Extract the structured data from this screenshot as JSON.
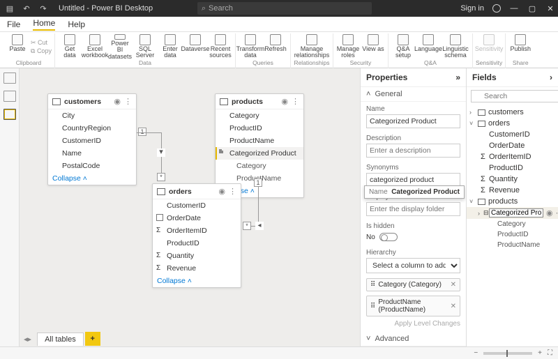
{
  "titlebar": {
    "title": "Untitled - Power BI Desktop",
    "search_placeholder": "Search",
    "signin": "Sign in"
  },
  "menu": {
    "file": "File",
    "home": "Home",
    "help": "Help"
  },
  "ribbon": {
    "clipboard": {
      "paste": "Paste",
      "cut": "Cut",
      "copy": "Copy",
      "group": "Clipboard"
    },
    "data": {
      "get": "Get data",
      "excel": "Excel workbook",
      "pbi": "Power BI datasets",
      "sql": "SQL Server",
      "enter": "Enter data",
      "dv": "Dataverse",
      "recent": "Recent sources",
      "group": "Data"
    },
    "queries": {
      "transform": "Transform data",
      "refresh": "Refresh",
      "group": "Queries"
    },
    "relationships": {
      "manage": "Manage relationships",
      "group": "Relationships"
    },
    "security": {
      "roles": "Manage roles",
      "viewas": "View as",
      "group": "Security"
    },
    "qa": {
      "setup": "Q&A setup",
      "lang": "Language",
      "ling": "Linguistic schema",
      "group": "Q&A"
    },
    "sens": {
      "btn": "Sensitivity",
      "group": "Sensitivity"
    },
    "share": {
      "publish": "Publish",
      "group": "Share"
    }
  },
  "tables": {
    "customers": {
      "name": "customers",
      "cols": [
        "City",
        "CountryRegion",
        "CustomerID",
        "Name",
        "PostalCode"
      ],
      "collapse": "Collapse"
    },
    "products": {
      "name": "products",
      "cols": [
        "Category",
        "ProductID",
        "ProductName"
      ],
      "hier": "Categorized Product",
      "hcols": [
        "Category",
        "ProductName"
      ],
      "collapse": "Collapse"
    },
    "orders": {
      "name": "orders",
      "cols": [
        "CustomerID",
        "OrderDate",
        "OrderItemID",
        "ProductID",
        "Quantity",
        "Revenue"
      ],
      "collapse": "Collapse"
    }
  },
  "props": {
    "title": "Properties",
    "general": "General",
    "name_label": "Name",
    "name_val": "Categorized Product",
    "desc_label": "Description",
    "desc_ph": "Enter a description",
    "syn_label": "Synonyms",
    "syn_val": "categorized product",
    "folder_label": "Display folder",
    "folder_ph": "Enter the display folder",
    "hidden_label": "Is hidden",
    "hidden_val": "No",
    "hier_label": "Hierarchy",
    "hier_ph": "Select a column to add level...",
    "level1": "Category (Category)",
    "level2": "ProductName (ProductName)",
    "apply": "Apply Level Changes",
    "advanced": "Advanced"
  },
  "fields": {
    "title": "Fields",
    "search_ph": "Search",
    "customers": "customers",
    "orders": "orders",
    "products": "products",
    "o_cols": [
      "CustomerID",
      "OrderDate",
      "OrderItemID",
      "ProductID",
      "Quantity",
      "Revenue"
    ],
    "p_hier": "Categorized Product",
    "p_cols": [
      "Category",
      "ProductID",
      "ProductName"
    ]
  },
  "tooltip": {
    "label": "Name",
    "val": "Categorized Product"
  },
  "bottom": {
    "tab": "All tables"
  },
  "rel": {
    "one": "1",
    "many": "*"
  }
}
